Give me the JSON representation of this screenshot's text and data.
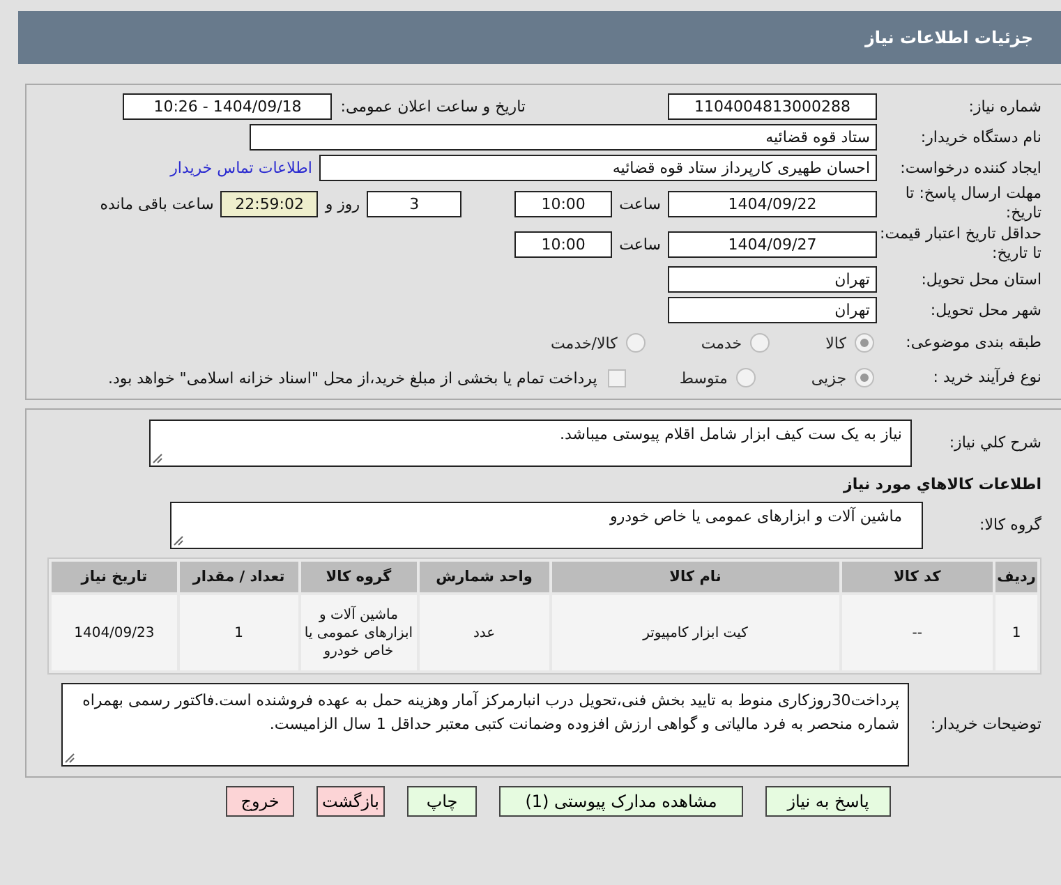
{
  "window": {
    "title": "جزئیات اطلاعات نیاز"
  },
  "need_number": {
    "label": "شماره نیاز:",
    "value": "1104004813000288"
  },
  "announce": {
    "label": "تاریخ و ساعت اعلان عمومی:",
    "value": "1404/09/18 - 10:26"
  },
  "buyer_org": {
    "label": "نام دستگاه خریدار:",
    "value": "ستاد قوه قضائیه"
  },
  "requester": {
    "label": "ایجاد کننده درخواست:",
    "value": "احسان طهیری کارپرداز ستاد قوه قضائیه",
    "link": "اطلاعات تماس خریدار"
  },
  "reply_deadline": {
    "label": "مهلت ارسال پاسخ: تا تاریخ:",
    "date": "1404/09/22",
    "time_label": "ساعت",
    "time": "10:00",
    "days": "3",
    "days_label": "روز و",
    "remaining": "22:59:02",
    "remaining_label": "ساعت باقی مانده"
  },
  "price_validity": {
    "label": "حداقل تاریخ اعتبار قیمت: تا تاریخ:",
    "date": "1404/09/27",
    "time_label": "ساعت",
    "time": "10:00"
  },
  "province": {
    "label": "استان محل تحویل:",
    "value": "تهران"
  },
  "city": {
    "label": "شهر محل تحویل:",
    "value": "تهران"
  },
  "category": {
    "label": "طبقه بندی موضوعی:",
    "options": [
      {
        "label": "کالا",
        "selected": true
      },
      {
        "label": "خدمت",
        "selected": false
      },
      {
        "label": "کالا/خدمت",
        "selected": false
      }
    ]
  },
  "purchase_type": {
    "label": "نوع فرآیند خرید :",
    "options": [
      {
        "label": "جزیی",
        "selected": true
      },
      {
        "label": "متوسط",
        "selected": false
      }
    ],
    "treasury": {
      "label": "پرداخت تمام یا بخشی از مبلغ خرید،از محل \"اسناد خزانه اسلامی\" خواهد بود.",
      "checked": false
    }
  },
  "description": {
    "label": "شرح کلي نياز:",
    "value": "نیاز به یک ست کیف ابزار شامل اقلام پیوستی میباشد."
  },
  "goods_heading": "اطلاعات کالاهاي مورد نياز",
  "goods_group": {
    "label": "گروه کالا:",
    "value": "ماشین آلات و ابزارهای عمومی یا خاص خودرو"
  },
  "table": {
    "columns": [
      "ردیف",
      "کد کالا",
      "نام کالا",
      "واحد شمارش",
      "گروه کالا",
      "تعداد / مقدار",
      "تاریخ نیاز"
    ],
    "rows": [
      [
        "1",
        "--",
        "کیت ابزار کامپیوتر",
        "عدد",
        "ماشین آلات و ابزارهای عمومی یا خاص خودرو",
        "1",
        "1404/09/23"
      ]
    ]
  },
  "buyer_notes": {
    "label": "توضیحات خریدار:",
    "value": "پرداخت30روزکاری منوط به تایید بخش فنی،تحویل درب انبارمرکز آمار وهزینه حمل به عهده فروشنده است.فاکتور رسمی بهمراه شماره منحصر به فرد مالیاتی و گواهی ارزش افزوده وضمانت کتبی معتبر حداقل 1 سال الزامیست."
  },
  "buttons": [
    {
      "label": "پاسخ به نیاز",
      "kind": "action"
    },
    {
      "label": "مشاهده مدارک پیوستی (1)",
      "kind": "action"
    },
    {
      "label": "چاپ",
      "kind": "action"
    },
    {
      "label": "بازگشت",
      "kind": "exit"
    },
    {
      "label": "خروج",
      "kind": "exit"
    }
  ]
}
